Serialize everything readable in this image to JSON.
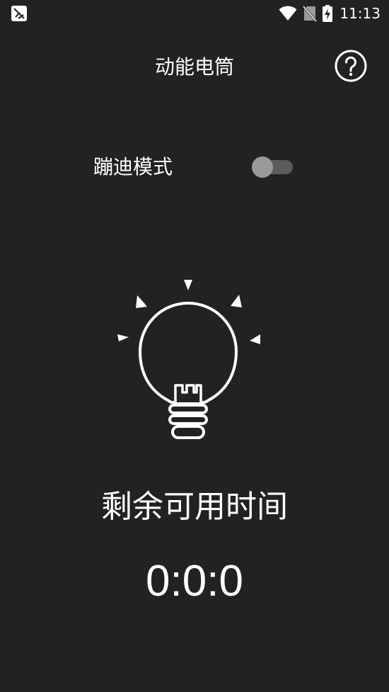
{
  "status_bar": {
    "time": "11:13",
    "icons": [
      "notification-app-icon",
      "wifi-icon",
      "no-sim-icon",
      "battery-charging-icon"
    ]
  },
  "header": {
    "title": "动能电筒",
    "help_icon": "question-circle-icon"
  },
  "settings": {
    "disco_mode_label": "蹦迪模式",
    "disco_mode_on": false
  },
  "bulb_icon": "light-bulb-icon",
  "timer": {
    "label": "剩余可用时间",
    "value": "0:0:0"
  },
  "colors": {
    "background": "#222222",
    "foreground": "#ffffff",
    "toggle_track": "#5c5c5c",
    "toggle_thumb": "#9a9a9a"
  }
}
